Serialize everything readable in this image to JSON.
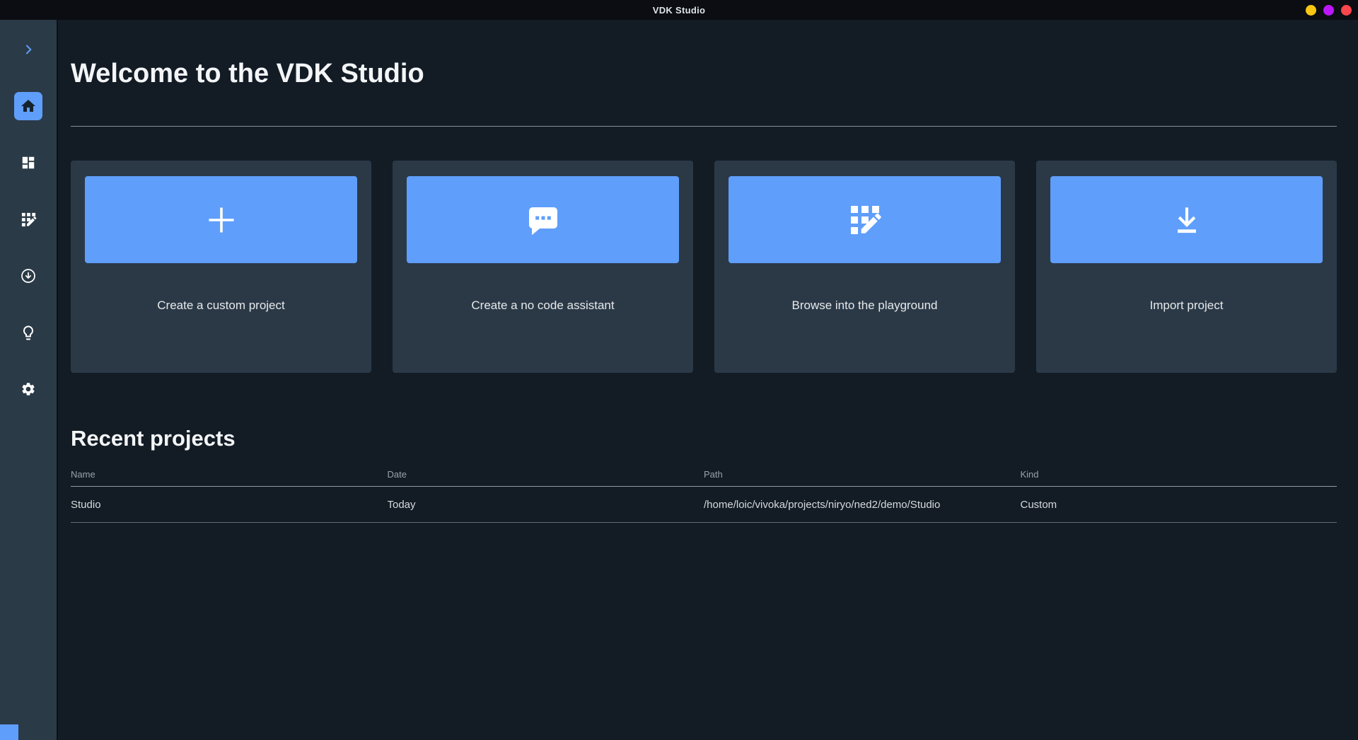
{
  "window": {
    "title": "VDK Studio",
    "controls": [
      {
        "name": "minimize",
        "color": "#f8c613"
      },
      {
        "name": "maximize",
        "color": "#bb17f8"
      },
      {
        "name": "close",
        "color": "#fa474d"
      }
    ]
  },
  "sidebar": {
    "items": [
      {
        "icon": "chevron-right-icon",
        "active": false
      },
      {
        "icon": "home-icon",
        "active": true
      },
      {
        "icon": "dashboard-icon",
        "active": false
      },
      {
        "icon": "grid-edit-icon",
        "active": false
      },
      {
        "icon": "download-circle-icon",
        "active": false
      },
      {
        "icon": "lightbulb-icon",
        "active": false
      },
      {
        "icon": "settings-gear-icon",
        "active": false
      }
    ]
  },
  "main": {
    "welcome_title": "Welcome to the VDK Studio",
    "cards": [
      {
        "icon": "plus-icon",
        "label": "Create a custom project"
      },
      {
        "icon": "chat-bubble-icon",
        "label": "Create a no code assistant"
      },
      {
        "icon": "grid-edit-icon",
        "label": "Browse into the playground"
      },
      {
        "icon": "download-arrow-icon",
        "label": "Import project"
      }
    ],
    "recent_projects": {
      "title": "Recent projects",
      "columns": [
        "Name",
        "Date",
        "Path",
        "Kind"
      ],
      "rows": [
        {
          "name": "Studio",
          "date": "Today",
          "path": "/home/loic/vivoka/projects/niryo/ned2/demo/Studio",
          "kind": "Custom"
        }
      ]
    }
  },
  "colors": {
    "accent_blue": "#5f9efb",
    "titlebar_bg": "#0b0d12",
    "sidebar_bg": "#2b3a47",
    "main_bg": "#131c25",
    "card_bg": "#2b3947"
  }
}
